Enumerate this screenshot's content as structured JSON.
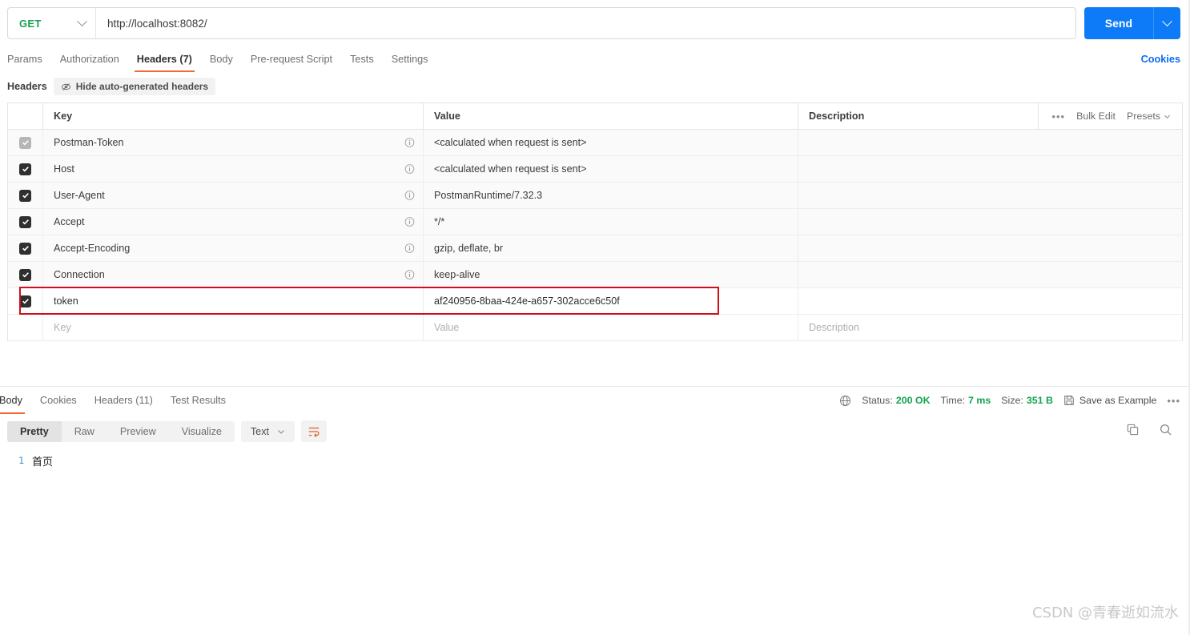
{
  "request_bar": {
    "method": "GET",
    "method_icon": "chevron-down-icon",
    "url": "http://localhost:8082/",
    "url_placeholder": "Enter request URL",
    "send_label": "Send",
    "send_caret_icon": "chevron-down-icon"
  },
  "request_tabs": {
    "items": [
      {
        "label": "Params",
        "active": false
      },
      {
        "label": "Authorization",
        "active": false
      },
      {
        "label": "Headers (7)",
        "active": true
      },
      {
        "label": "Body",
        "active": false
      },
      {
        "label": "Pre-request Script",
        "active": false
      },
      {
        "label": "Tests",
        "active": false
      },
      {
        "label": "Settings",
        "active": false
      }
    ],
    "cookies_link": "Cookies"
  },
  "headers_subbar": {
    "title": "Headers",
    "hide_auto_label": "Hide auto-generated headers",
    "hide_auto_icon": "eye-off-icon"
  },
  "headers_table": {
    "columns": [
      "Key",
      "Value",
      "Description"
    ],
    "actions": {
      "more_icon": "ellipsis-icon",
      "bulk_edit": "Bulk Edit",
      "presets": "Presets",
      "presets_icon": "chevron-down-icon"
    },
    "rows": [
      {
        "checked": true,
        "disabled": true,
        "info": true,
        "key": "Postman-Token",
        "value": "<calculated when request is sent>",
        "description": "",
        "highlight": false
      },
      {
        "checked": true,
        "disabled": false,
        "info": true,
        "key": "Host",
        "value": "<calculated when request is sent>",
        "description": "",
        "highlight": false
      },
      {
        "checked": true,
        "disabled": false,
        "info": true,
        "key": "User-Agent",
        "value": "PostmanRuntime/7.32.3",
        "description": "",
        "highlight": false
      },
      {
        "checked": true,
        "disabled": false,
        "info": true,
        "key": "Accept",
        "value": "*/*",
        "description": "",
        "highlight": false
      },
      {
        "checked": true,
        "disabled": false,
        "info": true,
        "key": "Accept-Encoding",
        "value": "gzip, deflate, br",
        "description": "",
        "highlight": false
      },
      {
        "checked": true,
        "disabled": false,
        "info": true,
        "key": "Connection",
        "value": "keep-alive",
        "description": "",
        "highlight": false
      },
      {
        "checked": true,
        "disabled": false,
        "info": false,
        "key": "token",
        "value": "af240956-8baa-424e-a657-302acce6c50f",
        "description": "",
        "highlight": true
      }
    ],
    "placeholder_row": {
      "key": "Key",
      "value": "Value",
      "description": "Description"
    },
    "highlight_color": "#cf0f20"
  },
  "response_tabs": {
    "items": [
      {
        "label": "Body",
        "active": true
      },
      {
        "label": "Cookies",
        "active": false
      },
      {
        "label": "Headers (11)",
        "active": false
      },
      {
        "label": "Test Results",
        "active": false
      }
    ]
  },
  "response_meta": {
    "globe_icon": "globe-icon",
    "status_label": "Status:",
    "status_value": "200 OK",
    "time_label": "Time:",
    "time_value": "7 ms",
    "size_label": "Size:",
    "size_value": "351 B",
    "save_icon": "save-icon",
    "save_label": "Save as Example",
    "more_icon": "ellipsis-icon",
    "ok_color": "#11a44c"
  },
  "body_toolbar": {
    "views": [
      {
        "label": "Pretty",
        "active": true
      },
      {
        "label": "Raw",
        "active": false
      },
      {
        "label": "Preview",
        "active": false
      },
      {
        "label": "Visualize",
        "active": false
      }
    ],
    "format": "Text",
    "format_icon": "chevron-down-icon",
    "wrap_icon": "wrap-text-icon",
    "copy_icon": "copy-icon",
    "search_icon": "search-icon"
  },
  "response_body": {
    "lines": [
      {
        "number": "1",
        "text": "首页"
      }
    ]
  },
  "watermark": "CSDN @青春逝如流水"
}
